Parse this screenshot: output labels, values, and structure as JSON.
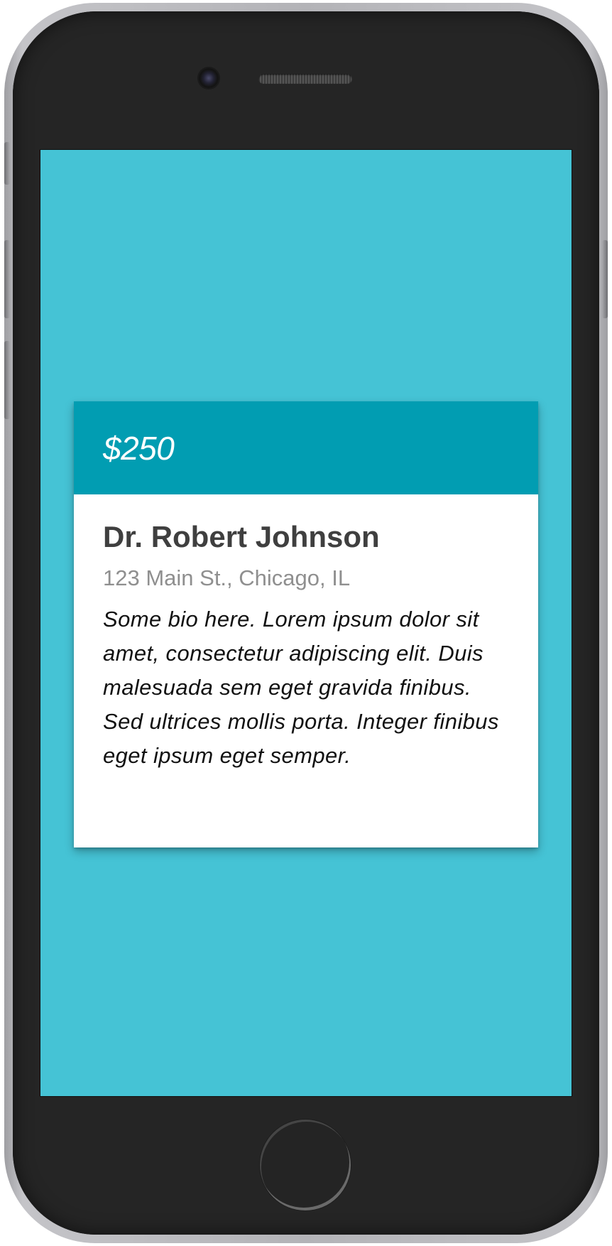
{
  "device": {
    "name": "phone",
    "screen_background": "#45c3d5"
  },
  "card": {
    "header_color": "#019db2",
    "price": "$250",
    "doctor_name": "Dr. Robert Johnson",
    "address": "123 Main St., Chicago, IL",
    "bio": "Some bio here. Lorem ipsum dolor sit amet, consectetur adipiscing elit. Duis malesuada sem eget gravida finibus. Sed ultrices mollis porta. Integer finibus eget ipsum eget semper."
  }
}
